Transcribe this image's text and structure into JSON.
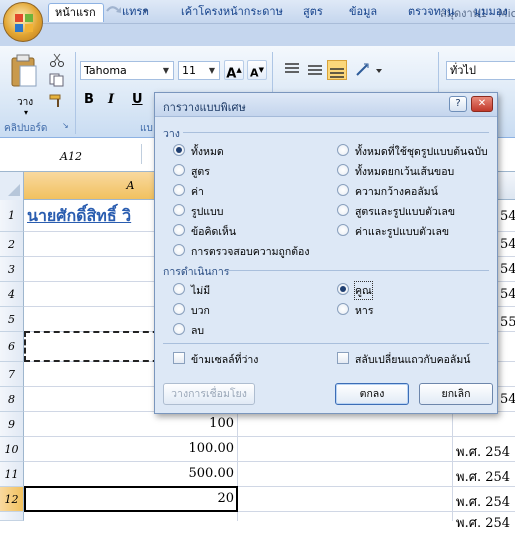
{
  "window": {
    "title": "สมุดงาน1 - Mic"
  },
  "quick_access": {
    "save_icon": "floppy-save-icon",
    "undo_icon": "undo-icon",
    "redo_icon": "redo-icon",
    "customize_icon": "dropdown-icon"
  },
  "tabs": [
    {
      "label": "หน้าแรก",
      "active": true
    },
    {
      "label": "แทรก"
    },
    {
      "label": "เค้าโครงหน้ากระดาษ"
    },
    {
      "label": "สูตร"
    },
    {
      "label": "ข้อมูล"
    },
    {
      "label": "ตรวจทาน"
    },
    {
      "label": "มุมมอง"
    }
  ],
  "ribbon": {
    "paste_label": "วาง",
    "clipboard_group": "คลิปบอร์ด",
    "font_name": "Tahoma",
    "font_size": "11",
    "bold": "B",
    "italic": "I",
    "underline": "U",
    "font_group_partial": "แบ",
    "grow_font": "A",
    "shrink_font": "A",
    "number_format": "ทั่วไป"
  },
  "formula_bar": {
    "name_box": "A12"
  },
  "grid": {
    "column_header": "A",
    "rows": [
      {
        "num": "1",
        "a": "นายศักดิ์สิทธิ์ วิ",
        "right": "54"
      },
      {
        "num": "2",
        "a": "",
        "right": "54"
      },
      {
        "num": "3",
        "a": "",
        "right": "54"
      },
      {
        "num": "4",
        "a": "",
        "right": "54"
      },
      {
        "num": "5",
        "a": "",
        "right": "55"
      },
      {
        "num": "6",
        "a": "",
        "right": ""
      },
      {
        "num": "7",
        "a": "",
        "right": ""
      },
      {
        "num": "8",
        "a": "",
        "right": "54"
      },
      {
        "num": "9",
        "a": "100",
        "right": ""
      },
      {
        "num": "10",
        "a": "100.00",
        "right": "พ.ศ. 254"
      },
      {
        "num": "11",
        "a": "500.00",
        "right": "พ.ศ. 254"
      },
      {
        "num": "12",
        "a": "20",
        "right": "พ.ศ. 254"
      },
      {
        "num": "",
        "a": "",
        "right": "พ.ศ. 254"
      }
    ]
  },
  "dialog": {
    "title": "การวางแบบพิเศษ",
    "help_button": "?",
    "close_button": "✕",
    "paste_section": "วาง",
    "paste_options_left": [
      {
        "label": "ทั้งหมด",
        "selected": true
      },
      {
        "label": "สูตร"
      },
      {
        "label": "ค่า"
      },
      {
        "label": "รูปแบบ"
      },
      {
        "label": "ข้อคิดเห็น"
      },
      {
        "label": "การตรวจสอบความถูกต้อง"
      }
    ],
    "paste_options_right": [
      {
        "label": "ทั้งหมดที่ใช้ชุดรูปแบบต้นฉบับ"
      },
      {
        "label": "ทั้งหมดยกเว้นเส้นขอบ"
      },
      {
        "label": "ความกว้างคอลัมน์"
      },
      {
        "label": "สูตรและรูปแบบตัวเลข"
      },
      {
        "label": "ค่าและรูปแบบตัวเลข"
      }
    ],
    "operation_section": "การดำเนินการ",
    "operation_left": [
      {
        "label": "ไม่มี"
      },
      {
        "label": "บวก"
      },
      {
        "label": "ลบ"
      }
    ],
    "operation_right": [
      {
        "label": "คูณ",
        "selected": true
      },
      {
        "label": "หาร"
      }
    ],
    "skip_blanks": "ข้ามเซลล์ที่ว่าง",
    "transpose": "สลับเปลี่ยนแถวกับคอลัมน์",
    "paste_link_button": "วางการเชื่อมโยง",
    "ok_button": "ตกลง",
    "cancel_button": "ยกเลิก"
  },
  "colors": {
    "accent": "#15428b",
    "selected_header": "#f1c15f",
    "hyperlink_text": "#2a5db0"
  }
}
